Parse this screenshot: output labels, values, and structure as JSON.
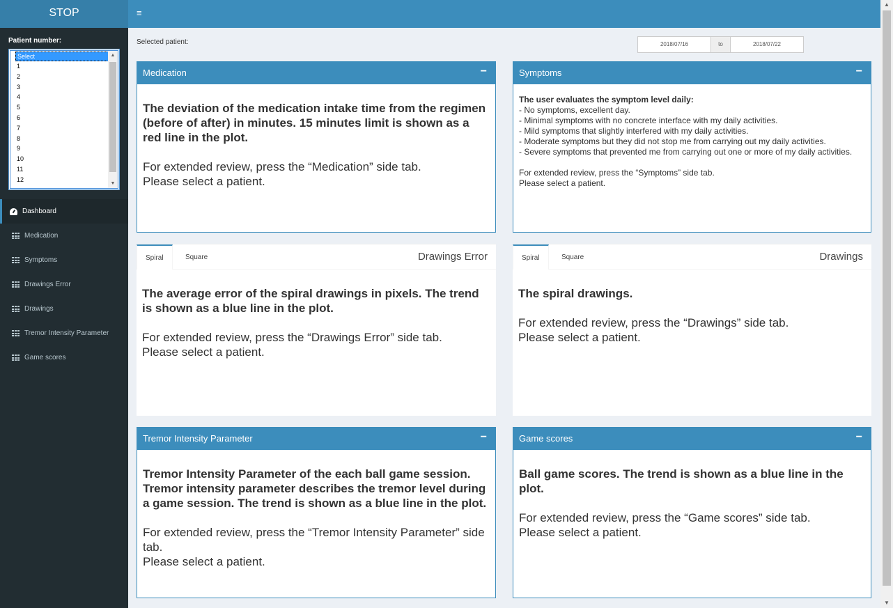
{
  "app": {
    "logo": "STOP"
  },
  "sidebar": {
    "patient_label": "Patient number:",
    "patient_options": [
      "Select",
      "1",
      "2",
      "3",
      "4",
      "5",
      "6",
      "7",
      "8",
      "9",
      "10",
      "11",
      "12"
    ],
    "selected_option": "Select",
    "menu": [
      {
        "label": "Dashboard",
        "icon": "dashboard-icon",
        "active": true
      },
      {
        "label": "Medication",
        "icon": "grid-icon"
      },
      {
        "label": "Symptoms",
        "icon": "grid-icon"
      },
      {
        "label": "Drawings Error",
        "icon": "grid-icon"
      },
      {
        "label": "Drawings",
        "icon": "grid-icon"
      },
      {
        "label": "Tremor Intensity Parameter",
        "icon": "grid-icon"
      },
      {
        "label": "Game scores",
        "icon": "grid-icon"
      }
    ]
  },
  "header": {
    "menu_toggle": "≡"
  },
  "main": {
    "selected_patient": "Selected patient:",
    "date_start": "2018/07/16",
    "date_sep": "to",
    "date_end": "2018/07/22",
    "medication": {
      "title": "Medication",
      "collapse": "−",
      "description": "The deviation of the medication intake time from the regimen (before of after) in minutes. 15 minutes limit is shown as a red line in the plot.",
      "review": "For extended review, press the “Medication” side tab.",
      "prompt": "Please select a patient."
    },
    "symptoms": {
      "title": "Symptoms",
      "collapse": "−",
      "heading": "The user evaluates the symptom level daily:",
      "levels": [
        "- No symptoms, excellent day.",
        "- Minimal symptoms with no concrete interface with my daily activities.",
        "- Mild symptoms that slightly interfered with my daily activities.",
        "- Moderate symptoms but they did not stop me from carrying out my daily activities.",
        "- Severe symptoms that prevented me from carrying out one or more of my daily activities."
      ],
      "review": "For extended review, press the “Symptoms” side tab.",
      "prompt": "Please select a patient."
    },
    "drawings_error": {
      "title": "Drawings Error",
      "tabs": [
        "Spiral",
        "Square"
      ],
      "description": "The average error of the spiral drawings in pixels. The trend is shown as a blue line in the plot.",
      "review": "For extended review, press the “Drawings Error” side tab.",
      "prompt": "Please select a patient."
    },
    "drawings": {
      "title": "Drawings",
      "tabs": [
        "Spiral",
        "Square"
      ],
      "description": "The spiral drawings.",
      "review": "For extended review, press the “Drawings” side tab.",
      "prompt": "Please select a patient."
    },
    "tremor": {
      "title": "Tremor Intensity Parameter",
      "collapse": "−",
      "description": "Tremor Intensity Parameter of the each ball game session. Tremor intensity parameter describes the tremor level during a game session. The trend is shown as a blue line in the plot.",
      "review": "For extended review, press the “Tremor Intensity Parameter” side tab.",
      "prompt": "Please select a patient."
    },
    "game_scores": {
      "title": "Game scores",
      "collapse": "−",
      "description": "Ball game scores. The trend is shown as a blue line in the plot.",
      "review": "For extended review, press the “Game scores” side tab.",
      "prompt": "Please select a patient."
    }
  },
  "colors": {
    "header": "#3c8dbc",
    "logo": "#367fa9",
    "sidebar": "#222d32",
    "content_bg": "#ecf0f5"
  }
}
